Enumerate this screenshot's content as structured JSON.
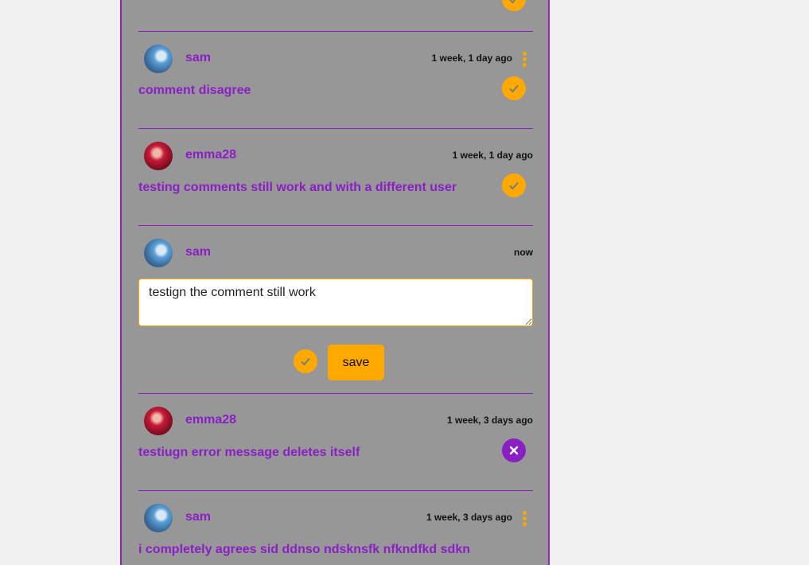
{
  "colors": {
    "accent": "#8a1fc4",
    "badge_ok": "#ffa800",
    "panel_bg": "#979797",
    "page_bg": "#f0f0f0"
  },
  "comments": [
    {
      "username": "sam",
      "timestamp": "1 week, 1 day ago",
      "text": "comment disagree",
      "status": "check-icon",
      "has_menu": true
    },
    {
      "username": "emma28",
      "timestamp": "1 week, 1 day ago",
      "text": "testing comments still work and with a different user",
      "status": "check-icon",
      "has_menu": false
    },
    {
      "username": "sam",
      "timestamp": "now",
      "editing": true,
      "edit_value": "testign the comment still work",
      "save_label": "save",
      "status": "check-icon"
    },
    {
      "username": "emma28",
      "timestamp": "1 week, 3 days ago",
      "text": "testiugn error message deletes itself",
      "status": "close-icon",
      "has_menu": false
    },
    {
      "username": "sam",
      "timestamp": "1 week, 3 days ago",
      "text": "i completely agrees sid ddnso ndsknsfk nfkndfkd sdkn",
      "status": "check-icon",
      "has_menu": true
    }
  ]
}
